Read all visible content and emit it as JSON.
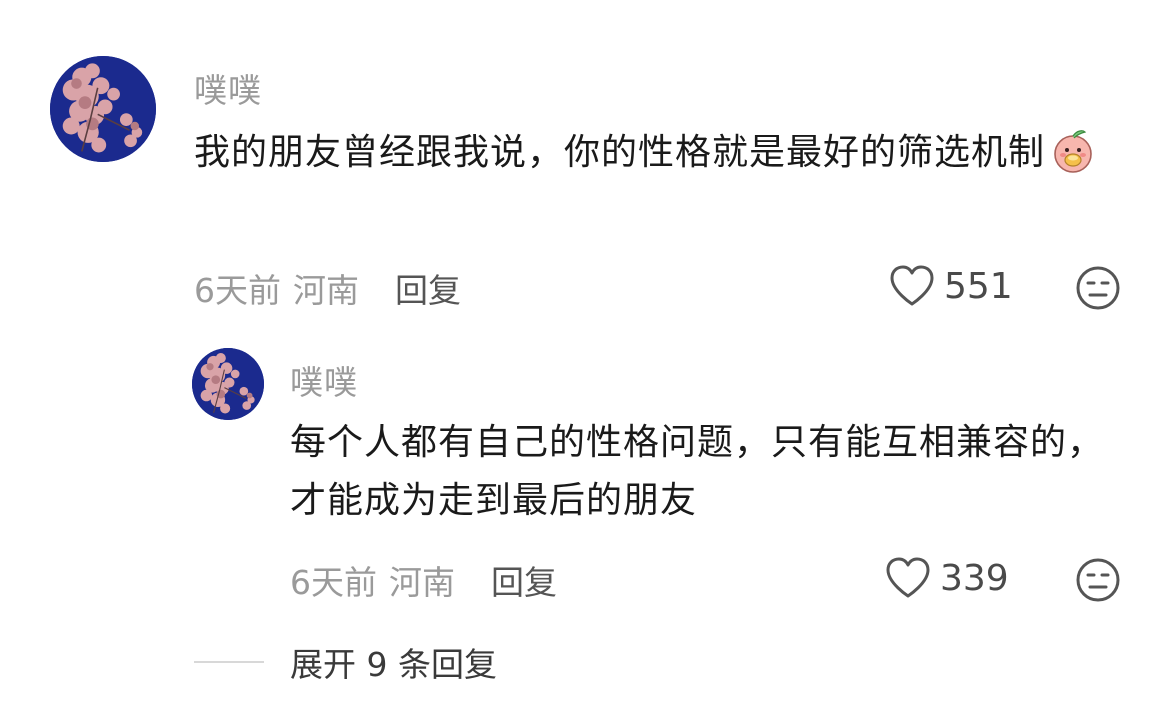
{
  "comment": {
    "username": "噗噗",
    "text": "我的朋友曾经跟我说，你的性格就是最好的筛选机制",
    "emoji": "peach-holding-food-icon",
    "time": "6天前",
    "location": "河南",
    "reply_label": "回复",
    "likes": "551"
  },
  "reply": {
    "username": "噗噗",
    "text": "每个人都有自己的性格问题，只有能互相兼容的，才能成为走到最后的朋友",
    "time": "6天前",
    "location": "河南",
    "reply_label": "回复",
    "likes": "339"
  },
  "expand_label": "展开 9 条回复",
  "colors": {
    "avatar_bg": "#1b2a8e",
    "meta_gray": "#9a9a9a"
  }
}
